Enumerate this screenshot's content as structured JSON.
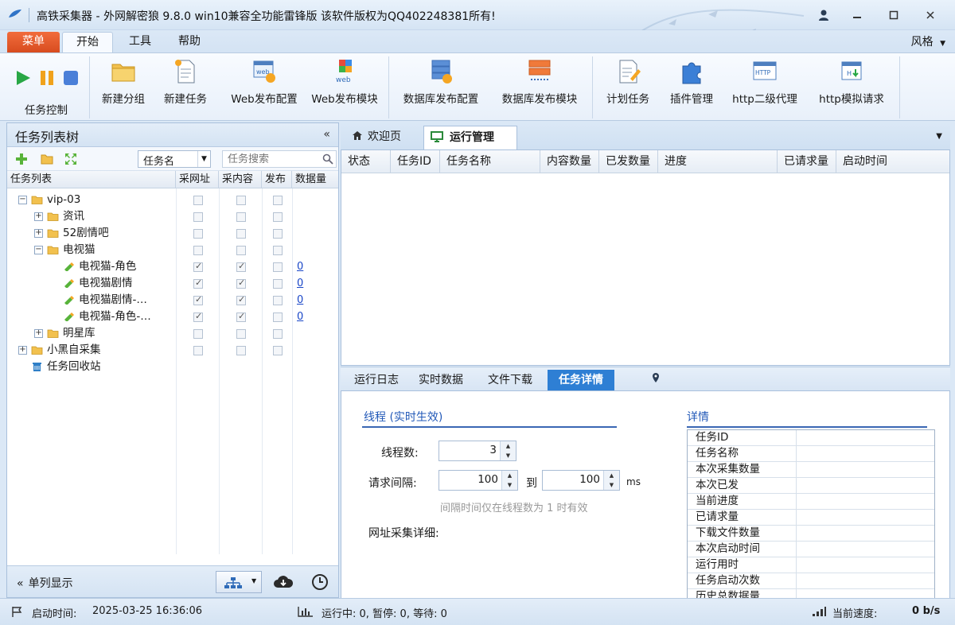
{
  "window": {
    "title": "高铁采集器 - 外网解密狼 9.8.0 win10兼容全功能雷锋版  该软件版权为QQ402248381所有!",
    "controls": [
      "user-icon",
      "minimize-icon",
      "maximize-icon",
      "close-icon"
    ]
  },
  "menu": {
    "tabs": [
      "菜单",
      "开始",
      "工具",
      "帮助"
    ],
    "active": "开始",
    "style_label": "风格"
  },
  "ribbon": {
    "task_control_label": "任务控制",
    "buttons": [
      {
        "label": "新建分组",
        "icon": "folder-icon"
      },
      {
        "label": "新建任务",
        "icon": "new-doc-icon"
      },
      {
        "label": "Web发布配置",
        "icon": "web-gear-icon"
      },
      {
        "label": "Web发布模块",
        "icon": "web-module-icon"
      },
      {
        "label": "数据库发布配置",
        "icon": "db-gear-icon"
      },
      {
        "label": "数据库发布模块",
        "icon": "db-module-icon"
      },
      {
        "label": "计划任务",
        "icon": "schedule-icon"
      },
      {
        "label": "插件管理",
        "icon": "plugin-icon"
      },
      {
        "label": "http二级代理",
        "icon": "http-icon"
      },
      {
        "label": "http模拟请求",
        "icon": "http-request-icon"
      }
    ]
  },
  "task_tree": {
    "title": "任务列表树",
    "collapse_glyph": "«",
    "search_field": "任务名",
    "search_placeholder": "任务搜索",
    "columns": [
      "任务列表",
      "采网址",
      "采内容",
      "发布",
      "数据量"
    ],
    "rows": [
      {
        "name": "vip-03",
        "level": 0,
        "type": "folder",
        "node": "−",
        "c1": false,
        "c2": false,
        "c3": false,
        "count": ""
      },
      {
        "name": "资讯",
        "level": 1,
        "type": "folder",
        "node": "+",
        "c1": false,
        "c2": false,
        "c3": false,
        "count": ""
      },
      {
        "name": "52剧情吧",
        "level": 1,
        "type": "folder",
        "node": "+",
        "c1": false,
        "c2": false,
        "c3": false,
        "count": ""
      },
      {
        "name": "电视猫",
        "level": 1,
        "type": "folder",
        "node": "−",
        "c1": false,
        "c2": false,
        "c3": false,
        "count": ""
      },
      {
        "name": "电视猫-角色",
        "level": 2,
        "type": "task",
        "node": "",
        "c1": true,
        "c2": true,
        "c3": false,
        "count": "0"
      },
      {
        "name": "电视猫剧情",
        "level": 2,
        "type": "task",
        "node": "",
        "c1": true,
        "c2": true,
        "c3": false,
        "count": "0"
      },
      {
        "name": "电视猫剧情-…",
        "level": 2,
        "type": "task",
        "node": "",
        "c1": true,
        "c2": true,
        "c3": false,
        "count": "0"
      },
      {
        "name": "电视猫-角色-…",
        "level": 2,
        "type": "task",
        "node": "",
        "c1": true,
        "c2": true,
        "c3": false,
        "count": "0"
      },
      {
        "name": "明星库",
        "level": 1,
        "type": "folder",
        "node": "+",
        "c1": false,
        "c2": false,
        "c3": false,
        "count": ""
      },
      {
        "name": "小黑自采集",
        "level": 0,
        "type": "folder",
        "node": "+",
        "c1": false,
        "c2": false,
        "c3": false,
        "count": ""
      },
      {
        "name": "任务回收站",
        "level": 0,
        "type": "trash",
        "node": "",
        "c1": null,
        "c2": null,
        "c3": null,
        "count": ""
      }
    ],
    "footer_label": "单列显示"
  },
  "top_tabs": {
    "welcome": "欢迎页",
    "run": "运行管理"
  },
  "run_grid": {
    "columns": [
      "状态",
      "任务ID",
      "任务名称",
      "内容数量",
      "已发数量",
      "进度",
      "已请求量",
      "启动时间"
    ]
  },
  "bottom_tabs": [
    "运行日志",
    "实时数据",
    "文件下载",
    "任务详情"
  ],
  "bottom_active": "任务详情",
  "thread": {
    "section_title": "线程 (实时生效)",
    "threads_label": "线程数:",
    "threads_value": "3",
    "interval_label": "请求间隔:",
    "interval_from": "100",
    "to_label": "到",
    "interval_to": "100",
    "unit": "ms",
    "hint": "间隔时间仅在线程数为 1 时有效",
    "url_detail_label": "网址采集详细:"
  },
  "detail": {
    "title": "详情",
    "rows": [
      "任务ID",
      "任务名称",
      "本次采集数量",
      "本次已发",
      "当前进度",
      "已请求量",
      "下载文件数量",
      "本次启动时间",
      "运行用时",
      "任务启动次数",
      "历史总数据量"
    ]
  },
  "status": {
    "start_time_label": "启动时间:",
    "start_time": "2025-03-25 16:36:06",
    "running": "运行中: 0,  暂停: 0,  等待: 0",
    "speed_label": "当前速度:",
    "speed": "0 b/s"
  },
  "colors": {
    "accent": "#2e7fd4",
    "menu_tab": "#e2562a",
    "play": "#28a745",
    "pause": "#f0a21c",
    "stop": "#4a7fd8"
  }
}
